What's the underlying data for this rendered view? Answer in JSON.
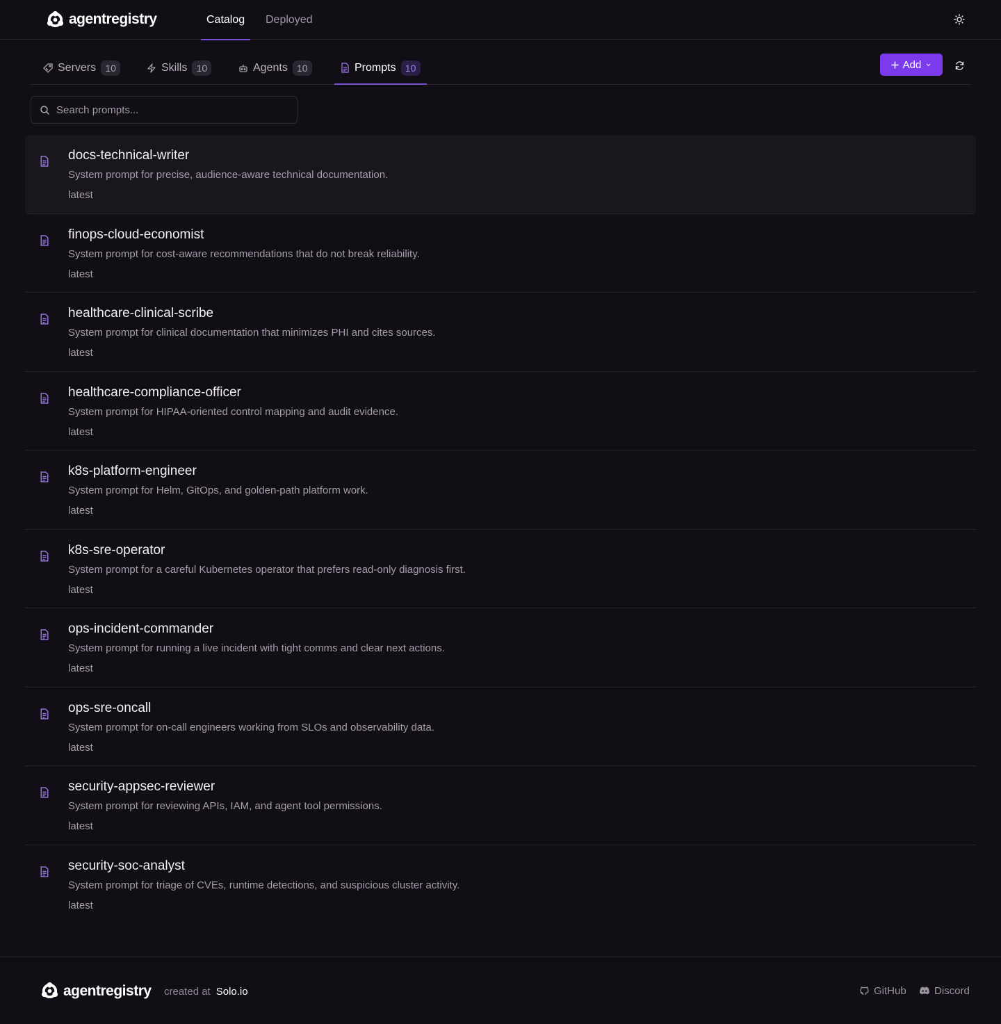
{
  "brand": {
    "name": "agentregistry"
  },
  "nav": {
    "catalog": "Catalog",
    "deployed": "Deployed"
  },
  "tabs": [
    {
      "label": "Servers",
      "count": "10",
      "icon": "server-tag-icon"
    },
    {
      "label": "Skills",
      "count": "10",
      "icon": "lightning-icon"
    },
    {
      "label": "Agents",
      "count": "10",
      "icon": "robot-icon"
    },
    {
      "label": "Prompts",
      "count": "10",
      "icon": "document-icon",
      "active": true
    }
  ],
  "toolbar": {
    "add_label": "Add"
  },
  "search": {
    "placeholder": "Search prompts..."
  },
  "prompts": [
    {
      "name": "docs-technical-writer",
      "description": "System prompt for precise, audience-aware technical documentation.",
      "version": "latest"
    },
    {
      "name": "finops-cloud-economist",
      "description": "System prompt for cost-aware recommendations that do not break reliability.",
      "version": "latest"
    },
    {
      "name": "healthcare-clinical-scribe",
      "description": "System prompt for clinical documentation that minimizes PHI and cites sources.",
      "version": "latest"
    },
    {
      "name": "healthcare-compliance-officer",
      "description": "System prompt for HIPAA-oriented control mapping and audit evidence.",
      "version": "latest"
    },
    {
      "name": "k8s-platform-engineer",
      "description": "System prompt for Helm, GitOps, and golden-path platform work.",
      "version": "latest"
    },
    {
      "name": "k8s-sre-operator",
      "description": "System prompt for a careful Kubernetes operator that prefers read-only diagnosis first.",
      "version": "latest"
    },
    {
      "name": "ops-incident-commander",
      "description": "System prompt for running a live incident with tight comms and clear next actions.",
      "version": "latest"
    },
    {
      "name": "ops-sre-oncall",
      "description": "System prompt for on-call engineers working from SLOs and observability data.",
      "version": "latest"
    },
    {
      "name": "security-appsec-reviewer",
      "description": "System prompt for reviewing APIs, IAM, and agent tool permissions.",
      "version": "latest"
    },
    {
      "name": "security-soc-analyst",
      "description": "System prompt for triage of CVEs, runtime detections, and suspicious cluster activity.",
      "version": "latest"
    }
  ],
  "footer": {
    "created_at": "created at",
    "company": "Solo.io",
    "github": "GitHub",
    "discord": "Discord"
  },
  "colors": {
    "accent": "#7c3aed",
    "background": "#120e15"
  }
}
